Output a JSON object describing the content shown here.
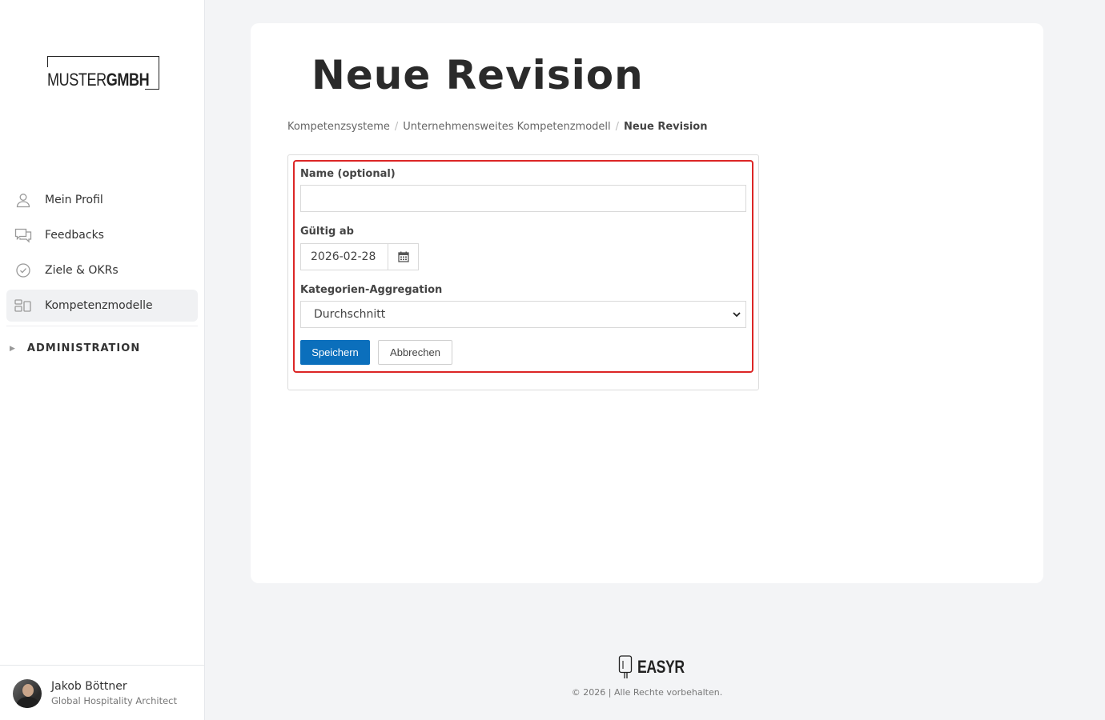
{
  "brand": {
    "logo_light": "MUSTER",
    "logo_bold": "GMBH"
  },
  "sidebar": {
    "items": [
      {
        "label": "Mein Profil",
        "icon": "user-icon",
        "active": false
      },
      {
        "label": "Feedbacks",
        "icon": "chat-icon",
        "active": false
      },
      {
        "label": "Ziele & OKRs",
        "icon": "check-circle-icon",
        "active": false
      },
      {
        "label": "Kompetenzmodelle",
        "icon": "grid-icon",
        "active": true
      }
    ],
    "admin_label": "ADMINISTRATION"
  },
  "user": {
    "name": "Jakob Böttner",
    "role": "Global Hospitality Architect"
  },
  "page": {
    "title": "Neue Revision",
    "breadcrumb": [
      "Kompetenzsysteme",
      "Unternehmensweites Kompetenzmodell",
      "Neue Revision"
    ]
  },
  "form": {
    "name_label": "Name (optional)",
    "name_value": "",
    "valid_label": "Gültig ab",
    "valid_value": "2026-02-28",
    "aggregation_label": "Kategorien-Aggregation",
    "aggregation_value": "Durchschnitt",
    "save_label": "Speichern",
    "cancel_label": "Abbrechen",
    "highlight_color": "#dc2626",
    "primary_color": "#0b6fbc"
  },
  "footer": {
    "logo": "EASYR",
    "copyright": "© 2026 | Alle Rechte vorbehalten."
  }
}
